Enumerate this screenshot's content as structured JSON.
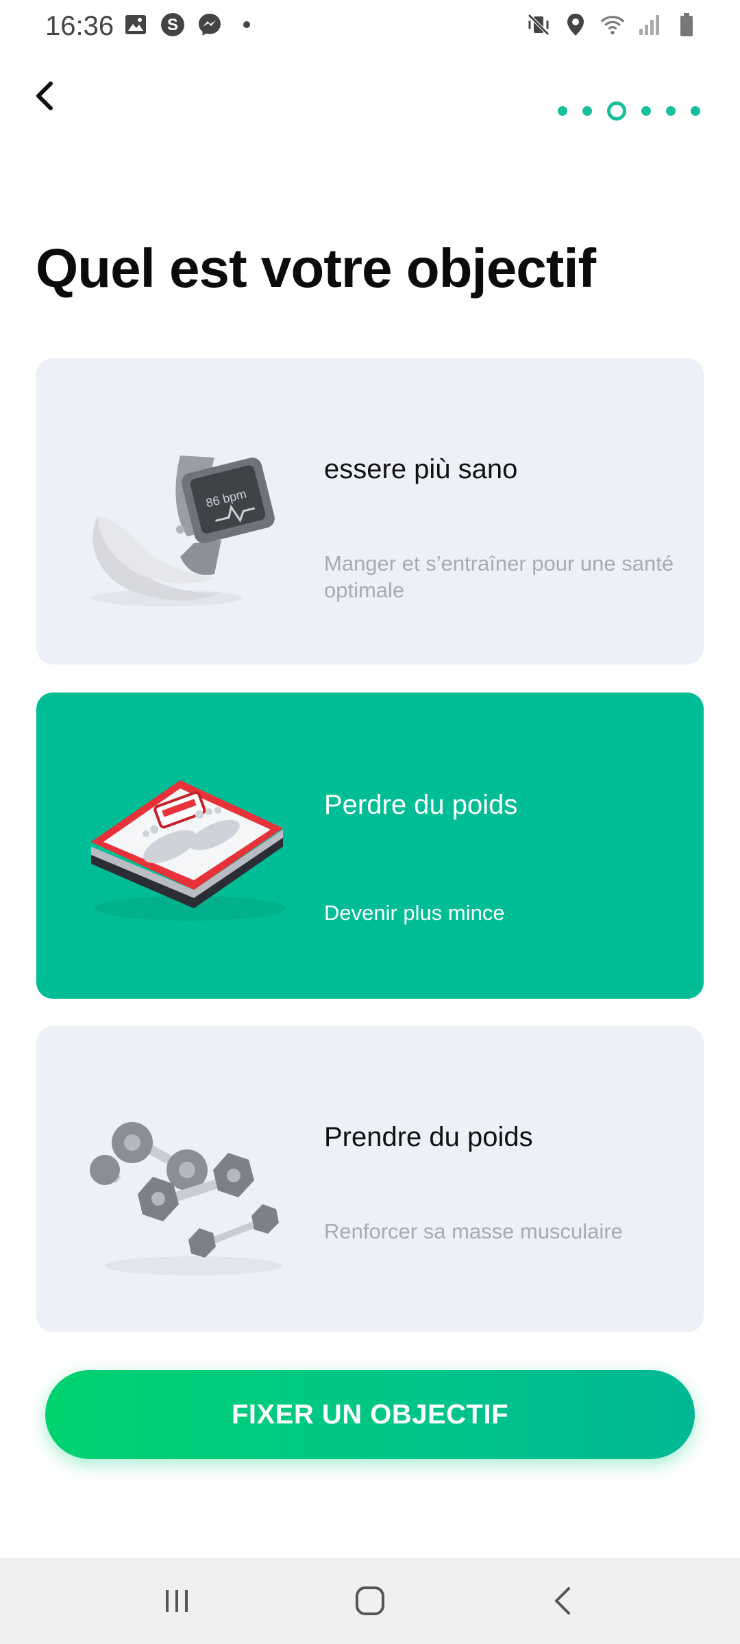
{
  "status_bar": {
    "time": "16:36",
    "left_icons": [
      "image-icon",
      "s-app-icon",
      "messenger-icon",
      "dot-icon"
    ],
    "right_icons": [
      "mute-vibrate-icon",
      "location-icon",
      "wifi-icon",
      "signal-icon",
      "battery-icon"
    ]
  },
  "header": {
    "back_icon": "chevron-left-icon",
    "steps_total": 6,
    "current_step": 3
  },
  "title": "Quel est votre objectif",
  "goals": [
    {
      "title": "essere più sano",
      "subtitle": "Manger et s’entraîner pour une santé optimale",
      "icon": "smartwatch-banana-icon",
      "selected": false
    },
    {
      "title": "Perdre du poids",
      "subtitle": "Devenir plus mince",
      "icon": "scale-icon",
      "selected": true
    },
    {
      "title": "Prendre du poids",
      "subtitle": "Renforcer sa masse musculaire",
      "icon": "dumbbells-icon",
      "selected": false
    }
  ],
  "cta": {
    "label": "FIXER UN OBJECTIF"
  },
  "nav_bar": {
    "icons": [
      "recent-apps-icon",
      "home-icon",
      "back-icon"
    ]
  },
  "colors": {
    "accent": "#00bd96",
    "card_bg": "#eef0f8",
    "cta_start": "#00d26f",
    "cta_end": "#00b894"
  }
}
